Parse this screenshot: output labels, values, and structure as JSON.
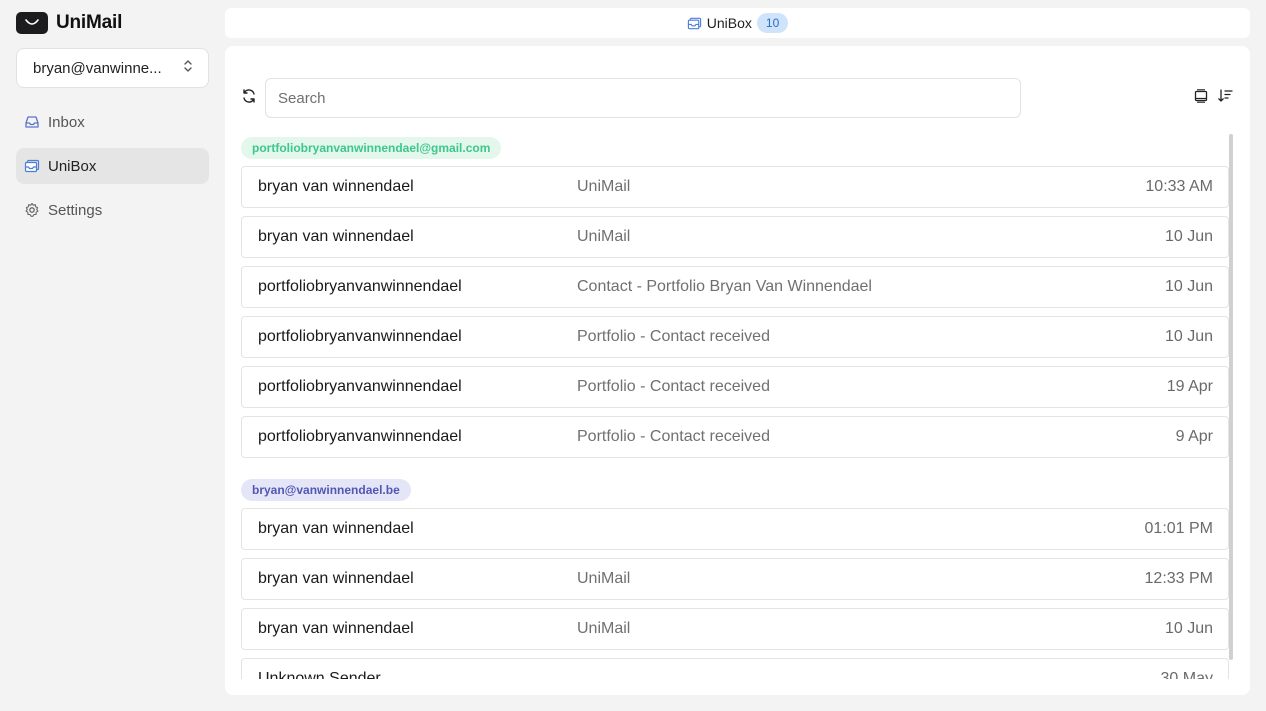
{
  "app": {
    "name": "UniMail"
  },
  "account": {
    "selected": "bryan@vanwinne..."
  },
  "nav": {
    "items": [
      {
        "label": "Inbox",
        "icon": "inbox-icon",
        "active": false
      },
      {
        "label": "UniBox",
        "icon": "unibox-icon",
        "active": true
      },
      {
        "label": "Settings",
        "icon": "gear-icon",
        "active": false
      }
    ]
  },
  "topbar": {
    "title": "UniBox",
    "count": "10"
  },
  "search": {
    "placeholder": "Search",
    "value": ""
  },
  "groups": [
    {
      "account": "portfoliobryanvanwinnendael@gmail.com",
      "color": "#3ec78a",
      "mails": [
        {
          "sender": "bryan van winnendael",
          "subject": "UniMail",
          "date": "10:33 AM"
        },
        {
          "sender": "bryan van winnendael",
          "subject": "UniMail",
          "date": "10 Jun"
        },
        {
          "sender": "portfoliobryanvanwinnendael",
          "subject": "Contact - Portfolio Bryan Van Winnendael",
          "date": "10 Jun"
        },
        {
          "sender": "portfoliobryanvanwinnendael",
          "subject": "Portfolio - Contact received",
          "date": "10 Jun"
        },
        {
          "sender": "portfoliobryanvanwinnendael",
          "subject": "Portfolio - Contact received",
          "date": "19 Apr"
        },
        {
          "sender": "portfoliobryanvanwinnendael",
          "subject": "Portfolio - Contact received",
          "date": "9 Apr"
        }
      ]
    },
    {
      "account": "bryan@vanwinnendael.be",
      "color": "#5157b3",
      "mails": [
        {
          "sender": "bryan van winnendael",
          "subject": "",
          "date": "01:01 PM"
        },
        {
          "sender": "bryan van winnendael",
          "subject": "UniMail",
          "date": "12:33 PM"
        },
        {
          "sender": "bryan van winnendael",
          "subject": "UniMail",
          "date": "10 Jun"
        },
        {
          "sender": "Unknown Sender",
          "subject": "",
          "date": "30 May"
        }
      ]
    }
  ]
}
